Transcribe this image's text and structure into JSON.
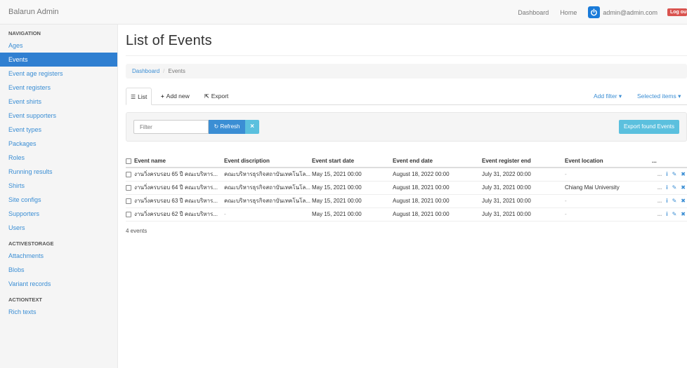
{
  "app": {
    "brand": "Balarun Admin"
  },
  "navbar": {
    "links": [
      "Dashboard",
      "Home"
    ],
    "user_email": "admin@admin.com",
    "logout_label": "Log out"
  },
  "sidebar": {
    "sections": [
      {
        "header": "NAVIGATION",
        "items": [
          "Ages",
          "Events",
          "Event age registers",
          "Event registers",
          "Event shirts",
          "Event supporters",
          "Event types",
          "Packages",
          "Roles",
          "Running results",
          "Shirts",
          "Site configs",
          "Supporters",
          "Users"
        ],
        "active_index": 1
      },
      {
        "header": "ACTIVESTORAGE",
        "items": [
          "Attachments",
          "Blobs",
          "Variant records"
        ]
      },
      {
        "header": "ACTIONTEXT",
        "items": [
          "Rich texts"
        ]
      }
    ]
  },
  "main": {
    "title": "List of Events",
    "breadcrumb": {
      "parent": "Dashboard",
      "separator": "/",
      "current": "Events"
    },
    "tabs": {
      "list": "List",
      "add_new": "Add new",
      "export": "Export",
      "add_filter": "Add filter",
      "selected_items": "Selected items"
    },
    "filter": {
      "placeholder": "Filter",
      "refresh_label": "Refresh",
      "clear_label": "×",
      "export_found": "Export found Events"
    },
    "table": {
      "columns": [
        "Event name",
        "Event discription",
        "Event start date",
        "Event end date",
        "Event register end",
        "Event location",
        "..."
      ],
      "rows": [
        [
          "งานวิ่งครบรอบ 65 ปี คณะบริหาร...",
          "คณะบริหารธุรกิจสถาบันเทคโนโล...",
          "May 15, 2021 00:00",
          "August 18, 2022 00:00",
          "July 31, 2022 00:00",
          "-"
        ],
        [
          "งานวิ่งครบรอบ 64 ปี คณะบริหาร...",
          "คณะบริหารธุรกิจสถาบันเทคโนโล...",
          "May 15, 2021 00:00",
          "August 18, 2021 00:00",
          "July 31, 2021 00:00",
          "Chiang Mai University"
        ],
        [
          "งานวิ่งครบรอบ 63 ปี คณะบริหาร...",
          "คณะบริหารธุรกิจสถาบันเทคโนโล...",
          "May 15, 2021 00:00",
          "August 18, 2021 00:00",
          "July 31, 2021 00:00",
          "-"
        ],
        [
          "งานวิ่งครบรอบ 62 ปี คณะบริหาร...",
          "-",
          "May 15, 2021 00:00",
          "August 18, 2021 00:00",
          "July 31, 2021 00:00",
          "-"
        ]
      ],
      "row_actions": {
        "more": "...",
        "info": "i",
        "edit": "✎",
        "delete": "✖"
      }
    },
    "count_text": "4 events"
  },
  "colors": {
    "link": "#3b8ed4",
    "active": "#2f7fd1",
    "info_button": "#5bc0de",
    "danger": "#d9534f"
  },
  "icons": {
    "list": "list-icon",
    "add": "plus-icon",
    "export": "export-icon",
    "refresh": "refresh-icon",
    "user": "power-icon"
  }
}
